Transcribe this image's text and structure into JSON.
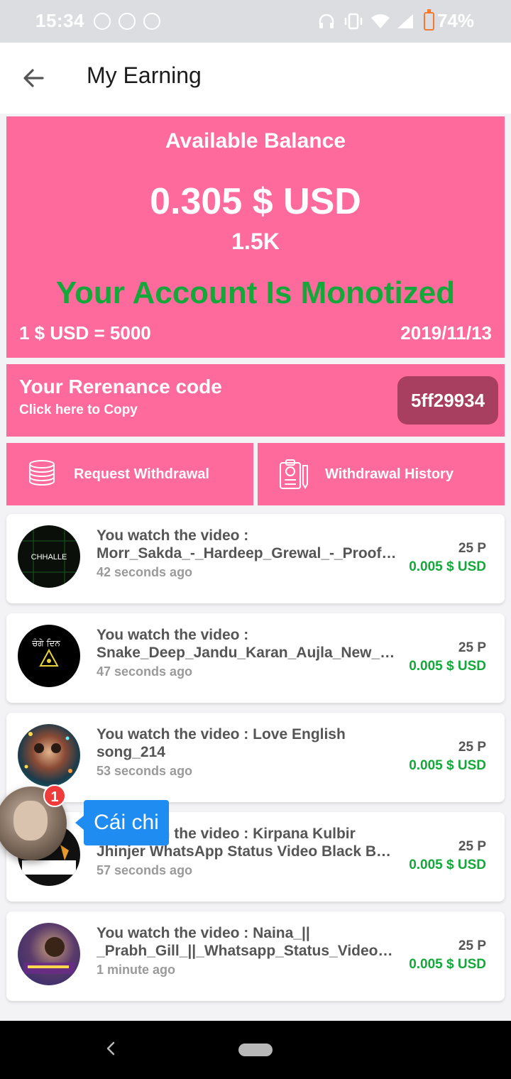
{
  "status_bar": {
    "time": "15:34",
    "battery": "74%",
    "icons": [
      "signal-app-icon",
      "messenger-icon",
      "messenger-outline-icon",
      "headphones-icon",
      "vibrate-icon",
      "wifi-icon",
      "cell-signal-icon",
      "battery-charging-icon"
    ]
  },
  "app_bar": {
    "title": "My Earning",
    "back_icon": "arrow-back-icon"
  },
  "balance": {
    "title": "Available Balance",
    "amount": "0.305 $ USD",
    "points": "1.5K",
    "status": "Your Account Is Monotized",
    "rate": "1 $ USD = 5000",
    "date": "2019/11/13"
  },
  "referral": {
    "title": "Your Rerenance code",
    "subtitle": "Click here to Copy",
    "code": "5ff29934"
  },
  "actions": {
    "withdraw_label": "Request Withdrawal",
    "history_label": "Withdrawal History"
  },
  "activity": [
    {
      "line1": "You watch the video :",
      "line2": "Morr_Sakda_-_Hardeep_Grewal_-_Proof_...",
      "time": "42 seconds ago",
      "points": "25 P",
      "usd": "0.005 $ USD",
      "thumb_text": "CHHALLE"
    },
    {
      "line1": "You watch the video :",
      "line2": "Snake_Deep_Jandu_Karan_Aujla_New_S...",
      "time": "47 seconds ago",
      "points": "25 P",
      "usd": "0.005 $ USD",
      "thumb_text": "ਚੰਗੇ ਦਿਨ"
    },
    {
      "line1": "You watch the video : Love English",
      "line2": "song_214",
      "time": "53 seconds ago",
      "points": "25 P",
      "usd": "0.005 $ USD",
      "thumb_text": ""
    },
    {
      "line1": "You watch the video : Kirpana Kulbir",
      "line2": "Jhinjer WhatsApp Status Video Black Bac...",
      "time": "57 seconds ago",
      "points": "25 P",
      "usd": "0.005 $ USD",
      "thumb_text": ""
    },
    {
      "line1": "You watch the video : Naina_||",
      "line2": "_Prabh_Gill_||_Whatsapp_Status_Video_||...",
      "time": "1 minute ago",
      "points": "25 P",
      "usd": "0.005 $ USD",
      "thumb_text": ""
    }
  ],
  "chat_head": {
    "badge": "1",
    "message": "Cái chi"
  },
  "colors": {
    "card_pink": "#ff6a9d",
    "code_bg": "#a83e60",
    "green": "#14a83b",
    "chat_blue": "#1e8cf0"
  }
}
